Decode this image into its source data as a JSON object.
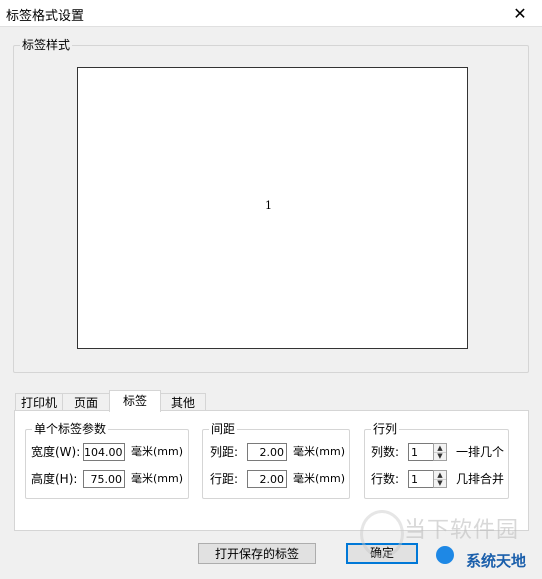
{
  "window": {
    "title": "标签格式设置",
    "close_symbol": "✕"
  },
  "preview_group": {
    "legend": "标签样式",
    "label_number": "1"
  },
  "tabs": [
    {
      "label": "打印机"
    },
    {
      "label": "页面"
    },
    {
      "label": "标签"
    },
    {
      "label": "其他"
    }
  ],
  "active_tab": "标签",
  "single_label": {
    "legend": "单个标签参数",
    "width_label": "宽度(W):",
    "width_value": "104.00",
    "width_unit": "毫米(mm)",
    "height_label": "高度(H):",
    "height_value": "75.00",
    "height_unit": "毫米(mm)"
  },
  "spacing": {
    "legend": "间距",
    "col_label": "列距:",
    "col_value": "2.00",
    "col_unit": "毫米(mm)",
    "row_label": "行距:",
    "row_value": "2.00",
    "row_unit": "毫米(mm)"
  },
  "rows_cols": {
    "legend": "行列",
    "cols_label": "列数:",
    "cols_value": "1",
    "cols_desc": "一排几个",
    "rows_label": "行数:",
    "rows_value": "1",
    "rows_desc": "几排合并"
  },
  "buttons": {
    "open_saved": "打开保存的标签",
    "ok": "确定"
  },
  "watermark": {
    "text": "当下软件园",
    "logo_text": "系统天地"
  }
}
